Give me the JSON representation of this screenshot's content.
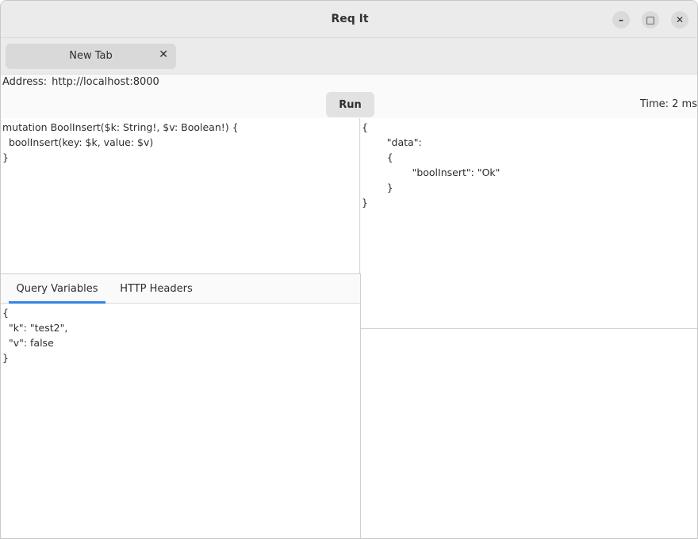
{
  "window": {
    "title": "Req It",
    "minimize_glyph": "–",
    "maximize_glyph": "□",
    "close_glyph": "✕"
  },
  "tabs": [
    {
      "label": "New Tab",
      "close_glyph": "✕"
    }
  ],
  "address": {
    "label": "Address:",
    "value": "http://localhost:8000"
  },
  "toolbar": {
    "run_label": "Run",
    "time_text": "Time: 2 ms"
  },
  "query": {
    "lines": [
      "mutation BoolInsert($k: String!, $v: Boolean!) {",
      "  boolInsert(key: $k, value: $v)",
      "}"
    ]
  },
  "response": {
    "lines": [
      "{",
      "        \"data\":",
      "        {",
      "                \"boolInsert\": \"Ok\"",
      "        }",
      "}"
    ]
  },
  "bottom_tabs": [
    {
      "label": "Query Variables",
      "active": true
    },
    {
      "label": "HTTP Headers",
      "active": false
    }
  ],
  "variables": {
    "lines": [
      "{",
      "  \"k\": \"test2\",",
      "  \"v\": false",
      "}"
    ]
  },
  "colors": {
    "accent": "#3584e4"
  }
}
